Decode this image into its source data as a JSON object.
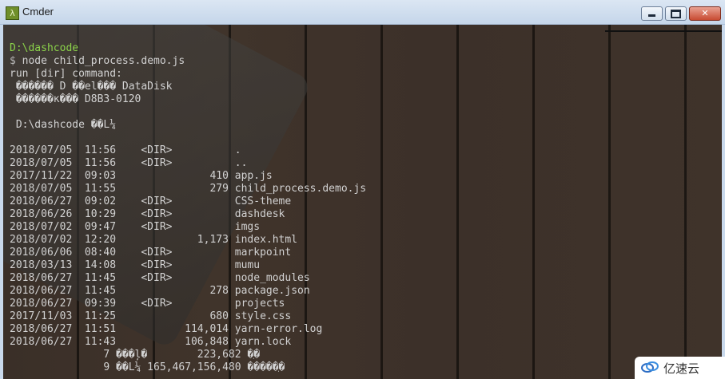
{
  "window": {
    "title": "Cmder",
    "icon": "lambda-icon",
    "icon_glyph": "λ",
    "controls": {
      "minimize": "minimize-icon",
      "maximize": "maximize-icon",
      "close_glyph": "✕"
    }
  },
  "terminal": {
    "prompt_path": "D:\\dashcode",
    "prompt_sign": "$",
    "command": " node child_process.demo.js",
    "lines": [
      "run [dir] command:",
      " ������ D ��el��� DataDisk",
      " ������к��� D8B3-0120",
      "",
      " D:\\dashcode ��L¼",
      "",
      "2018/07/05  11:56    <DIR>          .",
      "2018/07/05  11:56    <DIR>          ..",
      "2017/11/22  09:03               410 app.js",
      "2018/07/05  11:55               279 child_process.demo.js",
      "2018/06/27  09:02    <DIR>          CSS-theme",
      "2018/06/26  10:29    <DIR>          dashdesk",
      "2018/07/02  09:47    <DIR>          imgs",
      "2018/07/02  12:20             1,173 index.html",
      "2018/06/06  08:40    <DIR>          markpoint",
      "2018/03/13  14:08    <DIR>          mumu",
      "2018/06/27  11:45    <DIR>          node_modules",
      "2018/06/27  11:45               278 package.json",
      "2018/06/27  09:39    <DIR>          projects",
      "2017/11/03  11:25               680 style.css",
      "2018/06/27  11:51           114,014 yarn-error.log",
      "2018/06/27  11:43           106,848 yarn.lock",
      "               7 ���ļ�        223,682 �ֽ�",
      "               9 ��L¼ 165,467,156,480 �����ֽ�"
    ]
  },
  "colors": {
    "prompt_path": "#8bd24a",
    "text": "#d2d2d2",
    "background": "#3b3029"
  },
  "watermark": {
    "logo": "yisu-cloud-logo-icon",
    "text": "亿速云"
  }
}
